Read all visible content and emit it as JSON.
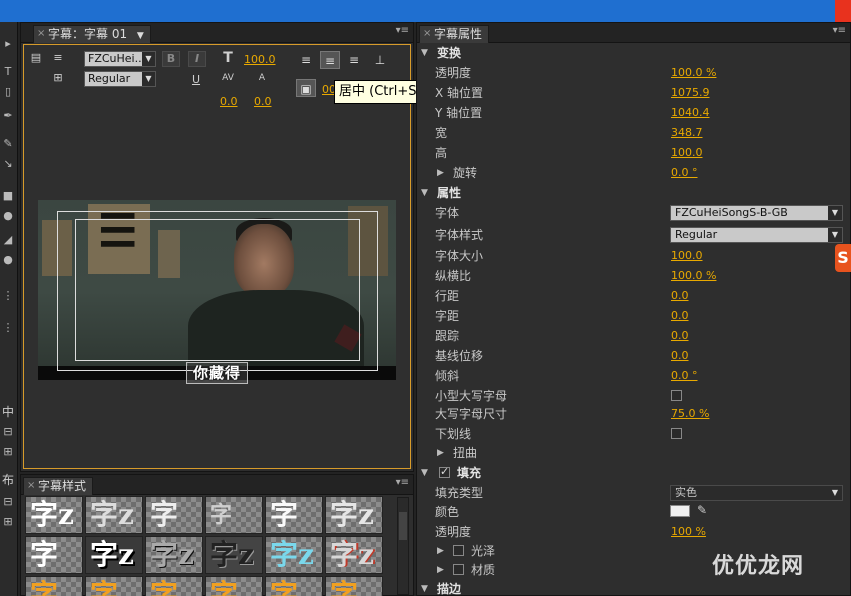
{
  "title_panel": {
    "tab_label": "字幕：字幕 01",
    "font_family": "FZCuHei...",
    "font_style": "Regular",
    "font_size": "100.0",
    "kerning": "0.0",
    "baseline": "0.0",
    "tab_stop": "00:",
    "tooltip": "居中 (Ctrl+Shift+C)",
    "caption_text": "你藏得"
  },
  "styles_panel": {
    "tab_label": "字幕样式",
    "swatch_glyph": "字",
    "swatch_glyph_z": "字z"
  },
  "props_panel": {
    "tab_label": "字幕属性",
    "transform": {
      "header": "变换",
      "opacity_label": "透明度",
      "opacity": "100.0 %",
      "x_label": "X 轴位置",
      "x": "1075.9",
      "y_label": "Y 轴位置",
      "y": "1040.4",
      "width_label": "宽",
      "width": "348.7",
      "height_label": "高",
      "height": "100.0",
      "rotation_label": "旋转",
      "rotation": "0.0 °"
    },
    "properties": {
      "header": "属性",
      "font_family_label": "字体",
      "font_family": "FZCuHeiSongS-B-GB",
      "font_style_label": "字体样式",
      "font_style": "Regular",
      "font_size_label": "字体大小",
      "font_size": "100.0",
      "aspect_label": "纵横比",
      "aspect": "100.0 %",
      "leading_label": "行距",
      "leading": "0.0",
      "kerning_label": "字距",
      "kerning": "0.0",
      "tracking_label": "跟踪",
      "tracking": "0.0",
      "baseline_label": "基线位移",
      "baseline": "0.0",
      "slant_label": "倾斜",
      "slant": "0.0 °",
      "small_caps_label": "小型大写字母",
      "small_caps_size_label": "大写字母尺寸",
      "small_caps_size": "75.0 %",
      "underline_label": "下划线",
      "distort_label": "扭曲"
    },
    "fill": {
      "header": "填充",
      "type_label": "填充类型",
      "type": "实色",
      "color_label": "颜色",
      "color": "#f0f0f0",
      "opacity_label": "透明度",
      "opacity": "100 %",
      "sheen_label": "光泽",
      "texture_label": "材质"
    },
    "stroke": {
      "header": "描边"
    }
  },
  "watermark": "优优龙网",
  "colors": {
    "accent": "#e8a900",
    "selection_border": "#d79b2a",
    "titlebar": "#1f6fd0"
  }
}
